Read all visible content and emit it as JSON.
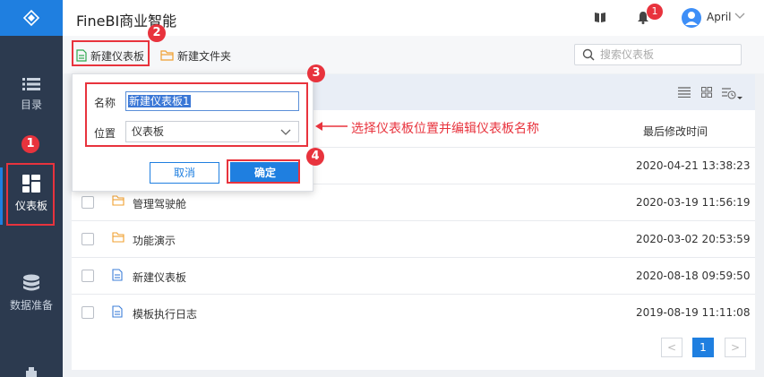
{
  "app": {
    "title": "FineBI商业智能"
  },
  "header": {
    "badge_count": "1",
    "username": "April"
  },
  "sidebar": {
    "items": [
      {
        "label": "目录",
        "icon": "list-icon"
      },
      {
        "label": "仪表板",
        "icon": "dashboard-icon",
        "active": true
      },
      {
        "label": "数据准备",
        "icon": "database-icon"
      }
    ]
  },
  "toolbar": {
    "new_dashboard_label": "新建仪表板",
    "new_folder_label": "新建文件夹",
    "search_placeholder": "搜索仪表板"
  },
  "table": {
    "col_time_header": "最后修改时间",
    "rows": [
      {
        "name": "",
        "time": "2020-04-21 13:38:23",
        "type": "folder"
      },
      {
        "name": "管理驾驶舱",
        "time": "2020-03-19 11:56:19",
        "type": "folder"
      },
      {
        "name": "功能演示",
        "time": "2020-03-02 20:53:59",
        "type": "folder"
      },
      {
        "name": "新建仪表板",
        "time": "2020-08-18 09:59:50",
        "type": "dashboard"
      },
      {
        "name": "模板执行日志",
        "time": "2019-08-19 11:11:08",
        "type": "dashboard"
      }
    ]
  },
  "pagination": {
    "prev": "<",
    "current": "1",
    "next": ">"
  },
  "dialog": {
    "name_label": "名称",
    "name_value": "新建仪表板1",
    "location_label": "位置",
    "location_value": "仪表板",
    "cancel_label": "取消",
    "ok_label": "确定"
  },
  "annotations": {
    "steps": [
      "1",
      "2",
      "3",
      "4"
    ],
    "hint": "选择仪表板位置并编辑仪表板名称"
  },
  "colors": {
    "accent": "#1f7fe0",
    "sidebar": "#2c3a4f",
    "annotation": "#e8333d"
  }
}
